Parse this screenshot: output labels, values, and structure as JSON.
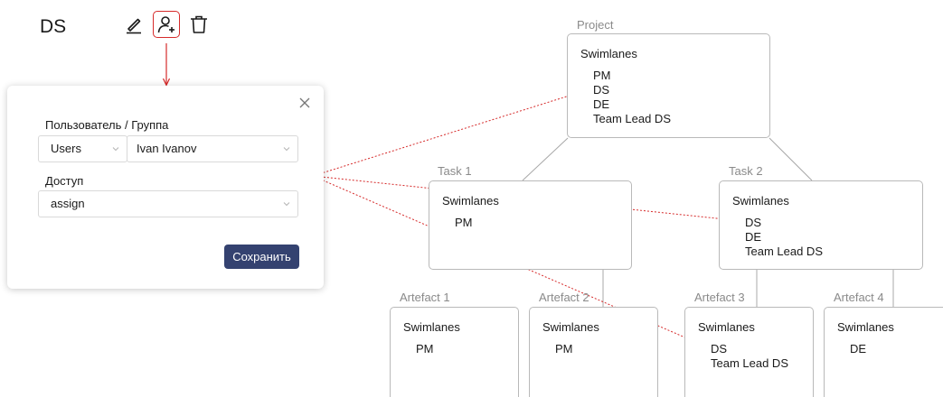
{
  "header": {
    "role_title": "DS",
    "icons": [
      "edit-icon",
      "add-user-icon",
      "trash-icon"
    ]
  },
  "modal": {
    "user_group_label": "Пользователь / Группа",
    "type_value": "Users",
    "user_value": "Ivan Ivanov",
    "access_label": "Доступ",
    "access_value": "assign",
    "save_label": "Сохранить"
  },
  "nodes": {
    "project": {
      "label": "Project",
      "title": "Swimlanes",
      "roles": [
        "PM",
        "DS",
        "DE",
        "Team Lead DS"
      ]
    },
    "task1": {
      "label": "Task 1",
      "title": "Swimlanes",
      "roles": [
        "PM"
      ]
    },
    "task2": {
      "label": "Task 2",
      "title": "Swimlanes",
      "roles": [
        "DS",
        "DE",
        "Team Lead DS"
      ]
    },
    "artefact1": {
      "label": "Artefact 1",
      "title": "Swimlanes",
      "roles": [
        "PM"
      ]
    },
    "artefact2": {
      "label": "Artefact 2",
      "title": "Swimlanes",
      "roles": [
        "PM"
      ]
    },
    "artefact3": {
      "label": "Artefact 3",
      "title": "Swimlanes",
      "roles": [
        "DS",
        "Team Lead DS"
      ]
    },
    "artefact4": {
      "label": "Artefact 4",
      "title": "Swimlanes",
      "roles": [
        "DE"
      ]
    }
  },
  "colors": {
    "accent": "#d62b2b",
    "button": "#344270",
    "border": "#b9b9b9",
    "label": "#8a8a8a"
  }
}
